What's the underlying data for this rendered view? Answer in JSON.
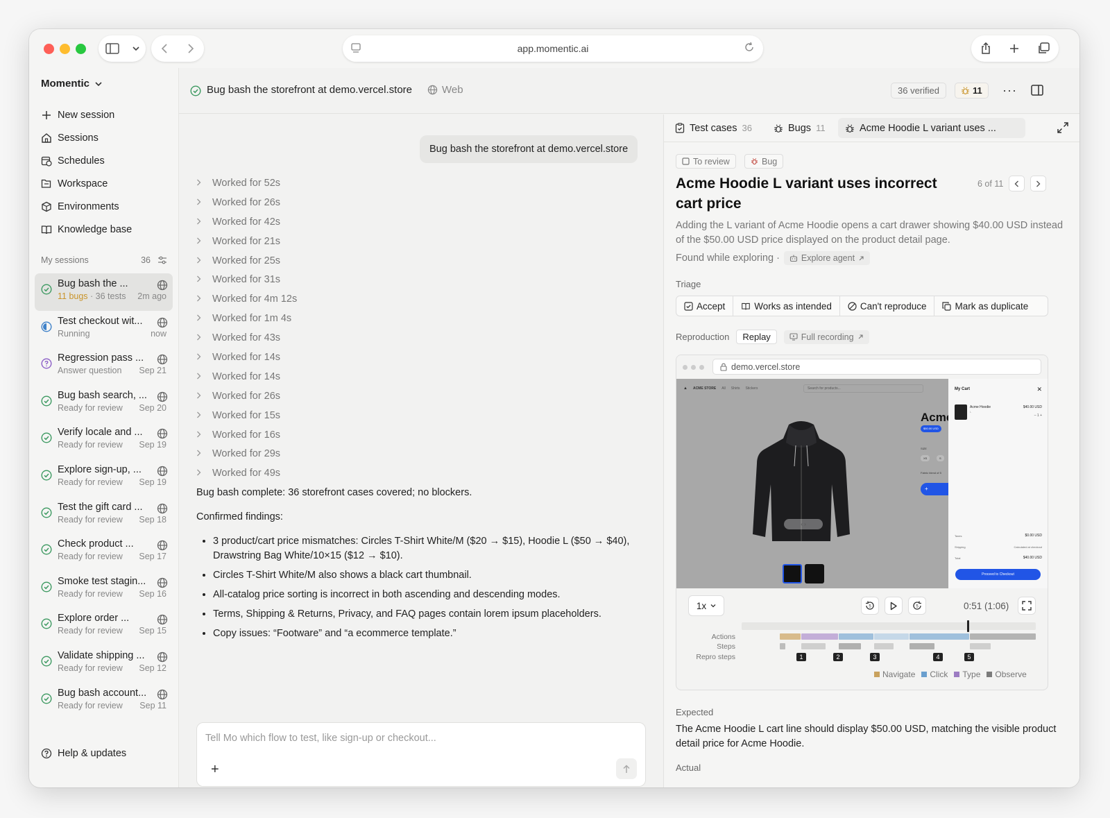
{
  "browser": {
    "url": "app.momentic.ai",
    "traffic_colors": [
      "#fe5f57",
      "#febc2e",
      "#28c840"
    ]
  },
  "sidebar": {
    "workspace_name": "Momentic",
    "nav": [
      {
        "label": "New session",
        "icon": "plus-icon"
      },
      {
        "label": "Sessions",
        "icon": "home-icon"
      },
      {
        "label": "Schedules",
        "icon": "calendar-clock-icon"
      },
      {
        "label": "Workspace",
        "icon": "folder-tree-icon"
      },
      {
        "label": "Environments",
        "icon": "box-icon"
      },
      {
        "label": "Knowledge base",
        "icon": "book-icon"
      }
    ],
    "my_sessions_label": "My sessions",
    "my_sessions_count": "36",
    "sessions": [
      {
        "title": "Bug bash the ...",
        "bugs": "11 bugs",
        "sub": " · 36 tests",
        "time": "2m ago",
        "status": "done",
        "active": true
      },
      {
        "title": "Test checkout wit...",
        "sub": "Running",
        "time": "now",
        "status": "running"
      },
      {
        "title": "Regression pass ...",
        "sub": "Answer question",
        "time": "Sep 21",
        "status": "question"
      },
      {
        "title": "Bug bash search, ...",
        "sub": "Ready for review",
        "time": "Sep 20",
        "status": "done"
      },
      {
        "title": "Verify locale and ...",
        "sub": "Ready for review",
        "time": "Sep 19",
        "status": "done"
      },
      {
        "title": "Explore sign-up, ...",
        "sub": "Ready for review",
        "time": "Sep 19",
        "status": "done"
      },
      {
        "title": "Test the gift card ...",
        "sub": "Ready for review",
        "time": "Sep 18",
        "status": "done"
      },
      {
        "title": "Check product ...",
        "sub": "Ready for review",
        "time": "Sep 17",
        "status": "done"
      },
      {
        "title": "Smoke test stagin...",
        "sub": "Ready for review",
        "time": "Sep 16",
        "status": "done"
      },
      {
        "title": "Explore order ...",
        "sub": "Ready for review",
        "time": "Sep 15",
        "status": "done"
      },
      {
        "title": "Validate shipping ...",
        "sub": "Ready for review",
        "time": "Sep 12",
        "status": "done"
      },
      {
        "title": "Bug bash account...",
        "sub": "Ready for review",
        "time": "Sep 11",
        "status": "done"
      }
    ],
    "help_label": "Help & updates"
  },
  "header": {
    "title": "Bug bash the storefront at demo.vercel.store",
    "platform": "Web",
    "verified": "36 verified",
    "bug_count": "11"
  },
  "chat": {
    "user_message": "Bug bash the storefront at demo.vercel.store",
    "worked": [
      "Worked for 52s",
      "Worked for 26s",
      "Worked for 42s",
      "Worked for 21s",
      "Worked for 25s",
      "Worked for 31s",
      "Worked for 4m 12s",
      "Worked for 1m 4s",
      "Worked for 43s",
      "Worked for 14s",
      "Worked for 14s",
      "Worked for 26s",
      "Worked for 15s",
      "Worked for 16s",
      "Worked for 29s",
      "Worked for 49s"
    ],
    "summary": "Bug bash complete: 36 storefront cases covered; no blockers.",
    "findings_label": "Confirmed findings:",
    "findings": [
      "3 product/cart price mismatches: Circles T-Shirt White/M ($20 → $15), Hoodie L ($50 → $40), Drawstring Bag White/10×15 ($12 → $10).",
      "Circles T-Shirt White/M also shows a black cart thumbnail.",
      "All-catalog price sorting is incorrect in both ascending and descending modes.",
      "Terms, Shipping & Returns, Privacy, and FAQ pages contain lorem ipsum placeholders.",
      "Copy issues: “Footware” and “a ecommerce template.”"
    ],
    "placeholder": "Tell Mo which flow to test, like sign-up or checkout..."
  },
  "panel": {
    "tabs": {
      "test_cases": "Test cases",
      "test_cases_count": "36",
      "bugs": "Bugs",
      "bugs_count": "11",
      "current": "Acme Hoodie L variant uses ..."
    },
    "tag_review": "To review",
    "tag_bug": "Bug",
    "title": "Acme Hoodie L variant uses incorrect cart price",
    "pager": "6 of 11",
    "description": "Adding the L variant of Acme Hoodie opens a cart drawer showing $40.00 USD instead of the $50.00 USD price displayed on the product detail page.",
    "found_label": "Found while exploring ·",
    "found_agent": "Explore agent",
    "triage_label": "Triage",
    "triage": [
      "Accept",
      "Works as intended",
      "Can't reproduce",
      "Mark as duplicate"
    ],
    "repro_label": "Reproduction",
    "replay": "Replay",
    "full_recording": "Full recording",
    "video": {
      "url": "demo.vercel.store",
      "store_name": "ACME STORE",
      "store_nav": [
        "All",
        "Shirts",
        "Stickers"
      ],
      "search": "Search for products...",
      "product": "Acme",
      "price_badge": "$50.00 USD",
      "size_label": "SIZE",
      "sizes": [
        "XS",
        "S"
      ],
      "fabric": "Fabric blend of 5",
      "cart_title": "My Cart",
      "cart_item": "Acme Hoodie",
      "cart_variant": "L",
      "cart_item_price": "$40.00 USD",
      "taxes_label": "Taxes",
      "taxes": "$0.00 USD",
      "shipping_label": "Shipping",
      "shipping": "Calculated at checkout",
      "total_label": "Total",
      "total": "$40.00 USD",
      "checkout": "Proceed to Checkout",
      "speed": "1x",
      "time": "0:51 (1:06)",
      "playhead_fraction": 0.77,
      "rows": [
        "Actions",
        "Steps",
        "Repro steps"
      ],
      "repro_steps": [
        "1",
        "2",
        "3",
        "4",
        "5"
      ],
      "legend": [
        {
          "label": "Navigate",
          "color": "#c9a25e"
        },
        {
          "label": "Click",
          "color": "#6a9fce"
        },
        {
          "label": "Type",
          "color": "#9c7cc2"
        },
        {
          "label": "Observe",
          "color": "#7b7b7b"
        }
      ]
    },
    "expected_label": "Expected",
    "expected": "The Acme Hoodie L cart line should display $50.00 USD, matching the visible product detail price for Acme Hoodie.",
    "actual_label": "Actual"
  }
}
